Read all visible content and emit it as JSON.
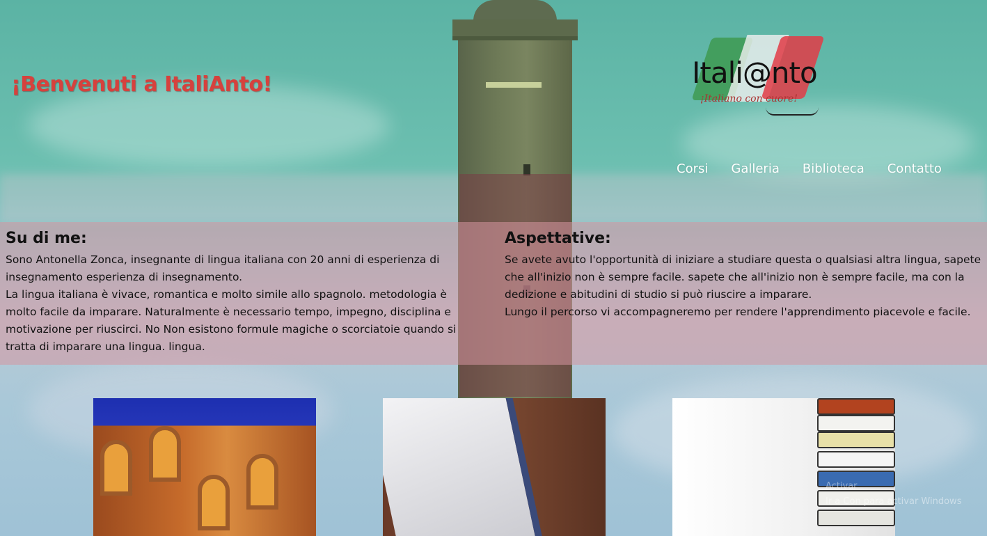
{
  "header": {
    "welcome": "¡Benvenuti a ItaliAnto!",
    "logo_text": "Itali@nto",
    "logo_tagline": "¡Italiano con cuore!"
  },
  "nav": {
    "items": [
      {
        "label": "Corsi"
      },
      {
        "label": "Galleria"
      },
      {
        "label": "Biblioteca"
      },
      {
        "label": "Contatto"
      }
    ]
  },
  "sections": {
    "left": {
      "title": "Su di me:",
      "paragraphs": [
        "Sono Antonella Zonca, insegnante di lingua italiana con 20 anni di esperienza di insegnamento esperienza di insegnamento.",
        "La lingua italiana è vivace, romantica e molto simile allo spagnolo. metodologia è molto facile da imparare. Naturalmente è necessario tempo, impegno, disciplina e motivazione per riuscirci. No Non esistono formule magiche o scorciatoie quando si tratta di imparare una lingua. lingua."
      ]
    },
    "right": {
      "title": "Aspettative:",
      "paragraphs": [
        "Se avete avuto l'opportunità di iniziare a studiare questa o qualsiasi altra lingua, sapete che all'inizio non è sempre facile. sapete che all'inizio non è sempre facile, ma con la dedizione e abitudini di studio si può riuscire a imparare.",
        "Lungo il percorso vi accompagneremo per rendere l'apprendimento piacevole e facile."
      ]
    }
  },
  "cards": [
    {
      "icon": "colosseum-photo"
    },
    {
      "icon": "notebook-on-wood-photo"
    },
    {
      "icon": "stack-of-books-photo"
    }
  ],
  "watermark": {
    "line1": "Activar",
    "line2": "Ir a Con para activar Windows"
  },
  "colors": {
    "welcome": "#d6413d",
    "band": "#d696a0",
    "nav_text": "#ffffff"
  }
}
